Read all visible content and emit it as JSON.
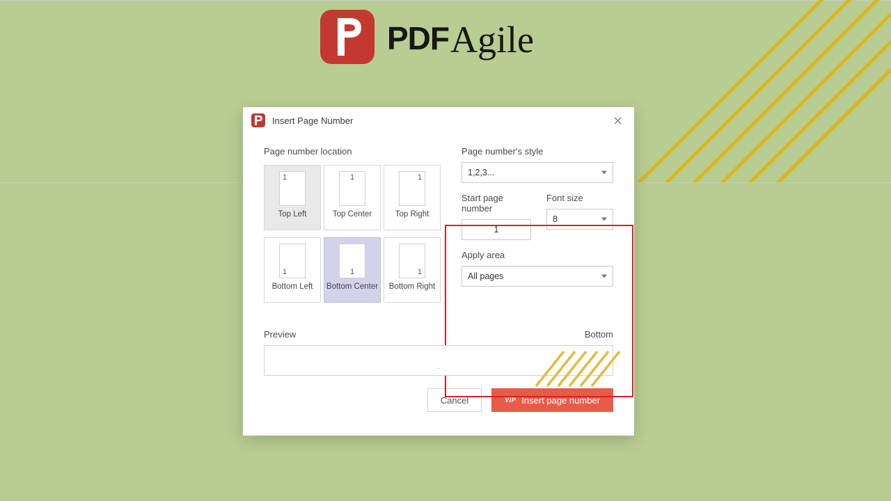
{
  "app": {
    "name": "PDFAgile",
    "logo_pdf": "PDF",
    "logo_agile": "Agile"
  },
  "dialog": {
    "title": "Insert Page Number",
    "left": {
      "location_label": "Page number location",
      "tiles": [
        {
          "key": "top-left",
          "caption": "Top Left",
          "pos": "tl"
        },
        {
          "key": "top-center",
          "caption": "Top Center",
          "pos": "tc"
        },
        {
          "key": "top-right",
          "caption": "Top Right",
          "pos": "tr"
        },
        {
          "key": "bottom-left",
          "caption": "Bottom Left",
          "pos": "bl"
        },
        {
          "key": "bottom-center",
          "caption": "Bottom Center",
          "pos": "bc"
        },
        {
          "key": "bottom-right",
          "caption": "Bottom Right",
          "pos": "br"
        }
      ],
      "selected_pos": "bc",
      "sample_digit": "1"
    },
    "right": {
      "style_label": "Page number's style",
      "style_value": "1,2,3...",
      "start_label": "Start page number",
      "start_value": "1",
      "fontsize_label": "Font size",
      "fontsize_value": "8",
      "area_label": "Apply area",
      "area_value": "All pages"
    },
    "preview": {
      "label": "Preview",
      "side": "Bottom",
      "tick": "."
    },
    "buttons": {
      "cancel": "Cancel",
      "insert": "Insert page number",
      "vip": "VIP"
    }
  }
}
